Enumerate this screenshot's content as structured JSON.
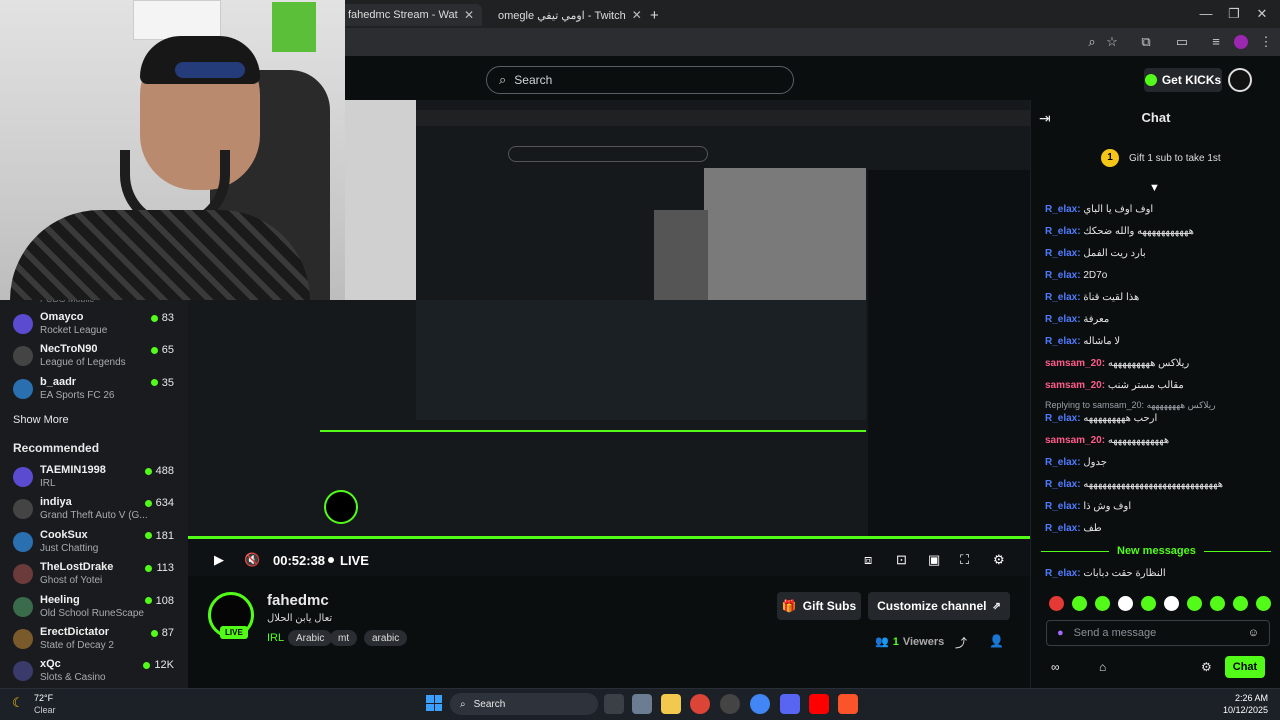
{
  "browser": {
    "tabs": [
      {
        "label": "fahedmc Stream - Watch Live o",
        "active": true
      },
      {
        "label": "omegle اومي تيفي - Twitch",
        "active": false
      }
    ],
    "new_tab": "+"
  },
  "header": {
    "search_placeholder": "Search",
    "get_kicks": "Get KICKs"
  },
  "sidebar": {
    "top_cut_label": "PUBG Mobile",
    "following": [
      {
        "name": "Omayco",
        "game": "Rocket League",
        "viewers": "83"
      },
      {
        "name": "NecTroN90",
        "game": "League of Legends",
        "viewers": "65"
      },
      {
        "name": "b_aadr",
        "game": "EA Sports FC 26",
        "viewers": "35"
      }
    ],
    "show_more": "Show More",
    "recommended_title": "Recommended",
    "recommended": [
      {
        "name": "TAEMIN1998",
        "game": "IRL",
        "viewers": "488"
      },
      {
        "name": "indiya",
        "game": "Grand Theft Auto V (G...",
        "viewers": "634"
      },
      {
        "name": "CookSux",
        "game": "Just Chatting",
        "viewers": "181"
      },
      {
        "name": "TheLostDrake",
        "game": "Ghost of Yotei",
        "viewers": "113"
      },
      {
        "name": "Heeling",
        "game": "Old School RuneScape",
        "viewers": "108"
      },
      {
        "name": "ErectDictator",
        "game": "State of Decay 2",
        "viewers": "87"
      },
      {
        "name": "xQc",
        "game": "Slots & Casino",
        "viewers": "12K"
      }
    ]
  },
  "player": {
    "time": "00:52:38",
    "live_label": "LIVE"
  },
  "channel": {
    "name": "fahedmc",
    "title": "تعال يابن الحلال",
    "category": "IRL",
    "tags": [
      "Arabic",
      "mt",
      "arabic"
    ],
    "live_badge": "LIVE",
    "gift_subs": "Gift Subs",
    "customize": "Customize channel",
    "viewers": "1",
    "viewers_label": "Viewers"
  },
  "chat": {
    "title": "Chat",
    "gift_promo": "Gift 1 sub to take 1st",
    "rank": "1",
    "messages": [
      {
        "user": "R_elax:",
        "text": "اوف اوف يا الباي",
        "color": "#4f7bff"
      },
      {
        "user": "R_elax:",
        "text": "هههههههههههه والله ضحكك",
        "color": "#4f7bff"
      },
      {
        "user": "R_elax:",
        "text": "بارد ريت الفمل",
        "color": "#4f7bff"
      },
      {
        "user": "R_elax:",
        "text": "2D7o",
        "color": "#4f7bff"
      },
      {
        "user": "R_elax:",
        "text": "هذا لقيت قناة",
        "color": "#4f7bff"
      },
      {
        "user": "R_elax:",
        "text": "معرفة",
        "color": "#4f7bff"
      },
      {
        "user": "R_elax:",
        "text": "لا ماشاله",
        "color": "#4f7bff"
      },
      {
        "user": "samsam_20:",
        "text": "ريلاكس هههههههههه",
        "color": "#ff5c8a"
      },
      {
        "user": "samsam_20:",
        "text": "مقالب مستر شنب",
        "color": "#ff5c8a"
      }
    ],
    "reply_note": "Replying to samsam_20: ريلاكس ههههههههه",
    "messages2": [
      {
        "user": "R_elax:",
        "text": "ارحب هههههههههه",
        "color": "#4f7bff"
      },
      {
        "user": "samsam_20:",
        "text": "ههههههههههههه",
        "color": "#ff5c8a"
      },
      {
        "user": "R_elax:",
        "text": "جدول",
        "color": "#4f7bff"
      },
      {
        "user": "R_elax:",
        "text": "هههههههههههههههههههههههههههههه",
        "color": "#4f7bff"
      },
      {
        "user": "R_elax:",
        "text": "اوف وش ذا",
        "color": "#4f7bff"
      },
      {
        "user": "R_elax:",
        "text": "طف",
        "color": "#4f7bff"
      }
    ],
    "new_messages": "New messages",
    "last_message": {
      "user": "R_elax:",
      "text": "النظارة حقت دبابات",
      "color": "#4f7bff"
    },
    "input_placeholder": "Send a message",
    "send_button": "Chat"
  },
  "taskbar": {
    "weather_temp": "72°F",
    "weather_desc": "Clear",
    "search": "Search",
    "time": "2:26 AM",
    "date": "10/12/2025"
  },
  "colors": {
    "accent": "#53fc18",
    "bg": "#0b0e0f",
    "sidebar": "#191b1f"
  }
}
